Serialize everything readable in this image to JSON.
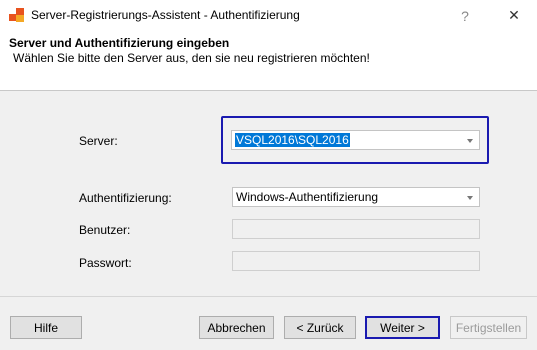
{
  "window": {
    "title": "Server-Registrierungs-Assistent - Authentifizierung",
    "icon": "app-icon",
    "help_button": "?",
    "close_button": "✕"
  },
  "header": {
    "title": "Server und Authentifizierung eingeben",
    "subtitle": "Wählen Sie bitte den Server aus, den sie neu registrieren möchten!"
  },
  "form": {
    "server": {
      "label": "Server:",
      "value": "VSQL2016\\SQL2016",
      "selected": true
    },
    "authentication": {
      "label": "Authentifizierung:",
      "value": "Windows-Authentifizierung"
    },
    "user": {
      "label": "Benutzer:",
      "value": "",
      "enabled": false
    },
    "password": {
      "label": "Passwort:",
      "value": "",
      "enabled": false
    }
  },
  "buttons": {
    "help": "Hilfe",
    "cancel": "Abbrechen",
    "back": "< Zurück",
    "next": "Weiter >",
    "finish": "Fertigstellen"
  },
  "colors": {
    "selection": "#0078d7",
    "focus_highlight": "#1a1ab0",
    "icon_orange": "#e8531e",
    "icon_yellow": "#f4a825"
  }
}
